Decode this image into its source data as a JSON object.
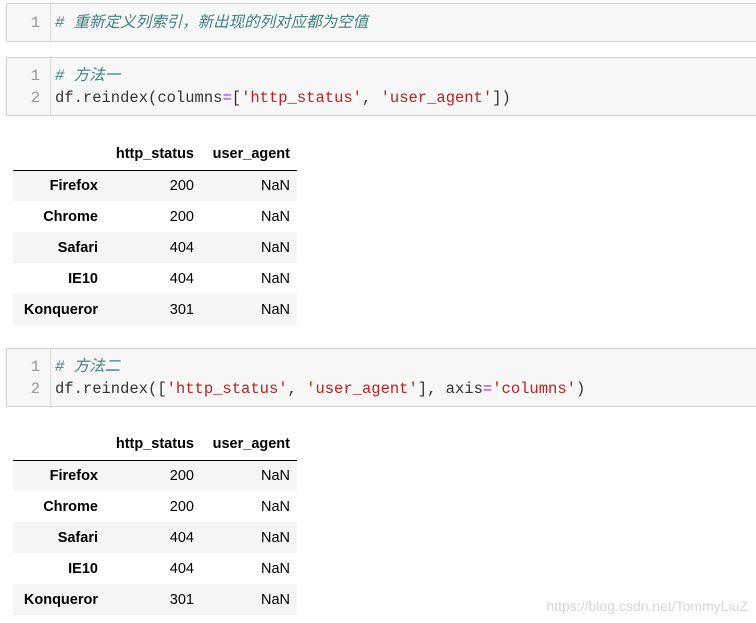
{
  "cells": [
    {
      "lines": [
        {
          "num": "1",
          "comment": "# 重新定义列索引，新出现的列对应都为空值"
        }
      ]
    },
    {
      "lines": [
        {
          "num": "1",
          "comment": "# 方法一"
        },
        {
          "num": "2",
          "prefix": "df.reindex(columns",
          "op": "=",
          "bracket_open": "[",
          "str1": "'http_status'",
          "sep": ", ",
          "str2": "'user_agent'",
          "suffix": "])"
        }
      ]
    },
    {
      "lines": [
        {
          "num": "1",
          "comment": "# 方法二"
        },
        {
          "num": "2",
          "prefix": "df.reindex([",
          "str1": "'http_status'",
          "sep": ", ",
          "str2": "'user_agent'",
          "mid": "], axis",
          "op": "=",
          "str3": "'columns'",
          "suffix": ")"
        }
      ]
    }
  ],
  "output_tables": [
    {
      "columns": [
        "",
        "http_status",
        "user_agent"
      ],
      "rows": [
        [
          "Firefox",
          "200",
          "NaN"
        ],
        [
          "Chrome",
          "200",
          "NaN"
        ],
        [
          "Safari",
          "404",
          "NaN"
        ],
        [
          "IE10",
          "404",
          "NaN"
        ],
        [
          "Konqueror",
          "301",
          "NaN"
        ]
      ]
    },
    {
      "columns": [
        "",
        "http_status",
        "user_agent"
      ],
      "rows": [
        [
          "Firefox",
          "200",
          "NaN"
        ],
        [
          "Chrome",
          "200",
          "NaN"
        ],
        [
          "Safari",
          "404",
          "NaN"
        ],
        [
          "IE10",
          "404",
          "NaN"
        ],
        [
          "Konqueror",
          "301",
          "NaN"
        ]
      ]
    }
  ],
  "watermark": "https://blog.csdn.net/TommyLiuZ"
}
